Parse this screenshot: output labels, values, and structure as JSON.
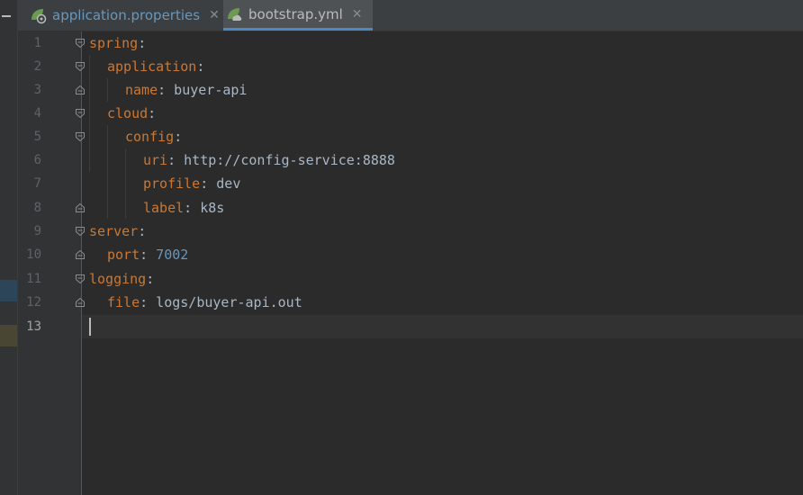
{
  "tabs": [
    {
      "label": "application.properties",
      "close": "✕",
      "active": false
    },
    {
      "label": "bootstrap.yml",
      "close": "✕",
      "active": true
    }
  ],
  "gutter": {
    "line_numbers": [
      "1",
      "2",
      "3",
      "4",
      "5",
      "6",
      "7",
      "8",
      "9",
      "10",
      "11",
      "12",
      "13"
    ],
    "current_line": "13"
  },
  "code": {
    "lines": [
      {
        "key": "spring",
        "sep": ":",
        "value": ""
      },
      {
        "key": "application",
        "sep": ":",
        "value": ""
      },
      {
        "key": "name",
        "sep": ":",
        "value": " buyer-api"
      },
      {
        "key": "cloud",
        "sep": ":",
        "value": ""
      },
      {
        "key": "config",
        "sep": ":",
        "value": ""
      },
      {
        "key": "uri",
        "sep": ":",
        "value": " http://config-service:8888"
      },
      {
        "key": "profile",
        "sep": ":",
        "value": " dev"
      },
      {
        "key": "label",
        "sep": ":",
        "value": " k8s"
      },
      {
        "key": "server",
        "sep": ":",
        "value": ""
      },
      {
        "key": "port",
        "sep": ":",
        "value": " 7002"
      },
      {
        "key": "logging",
        "sep": ":",
        "value": ""
      },
      {
        "key": "file",
        "sep": ":",
        "value": " logs/buyer-api.out"
      }
    ]
  },
  "colors": {
    "background": "#2b2b2b",
    "key": "#cc7832",
    "text": "#a9b7c6",
    "number": "#6897bb",
    "active_tab_underline": "#4a88c7"
  },
  "icons": {
    "tab_icon": "spring-leaf-icon",
    "fold": "fold-marker-icon"
  }
}
